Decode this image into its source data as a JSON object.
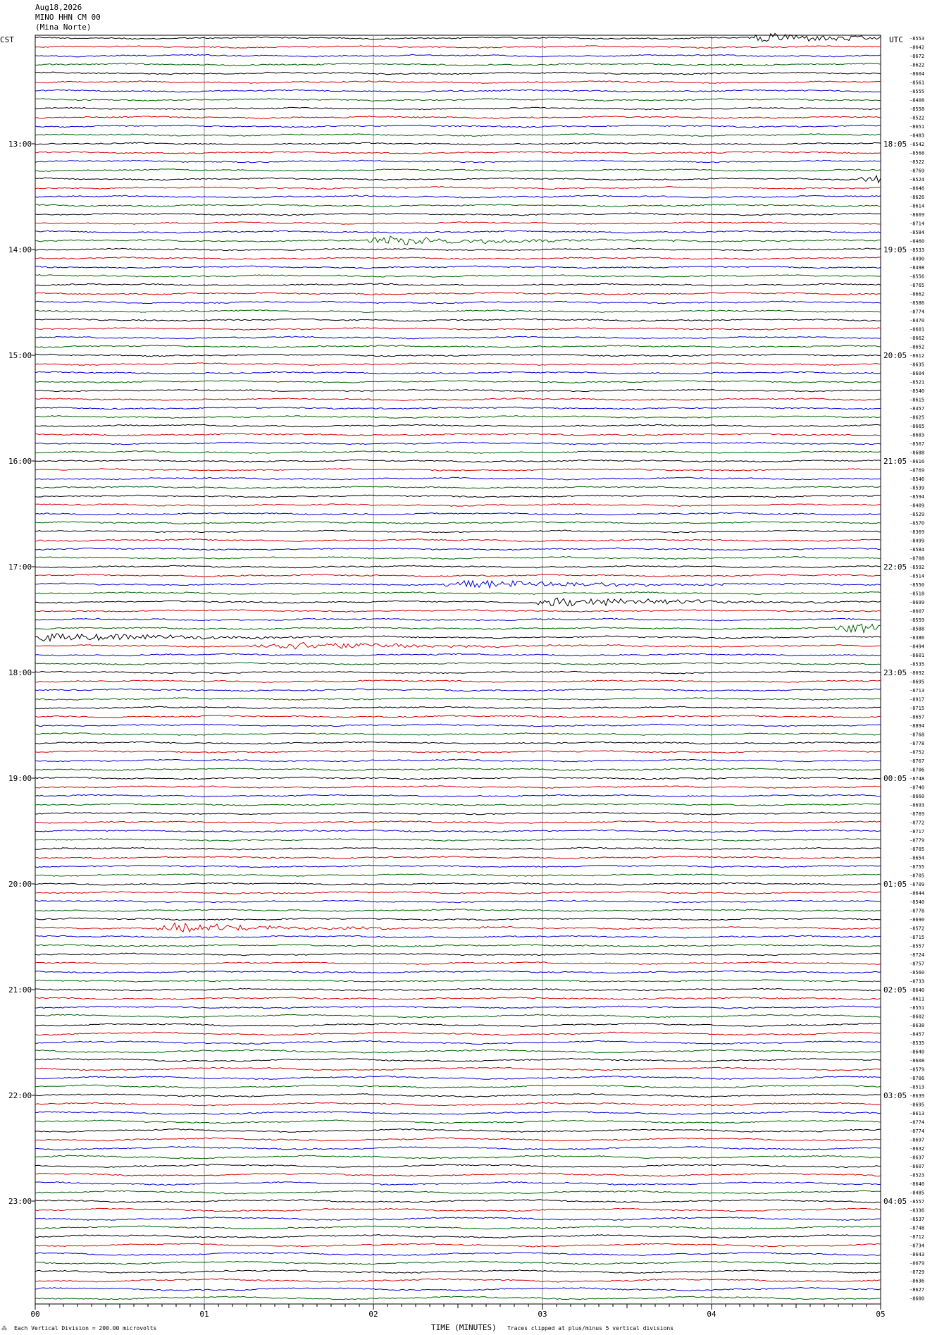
{
  "header": {
    "date": "Aug18,2026",
    "station": "MINO HHN CM 00",
    "location": "(Mina Norte)"
  },
  "left_tz": "CST",
  "right_tz": "UTC",
  "footer": {
    "scale_note": "Each Vertical Division =  200.00 microvolts",
    "xlabel": "TIME (MINUTES)",
    "clip_note": "Traces clipped at plus/minus 5 vertical divisions"
  },
  "chart_data": {
    "type": "line",
    "title": "",
    "xlabel": "TIME (MINUTES)",
    "ylabel": "",
    "xlim": [
      0,
      5
    ],
    "x_ticks": [
      "00",
      "01",
      "02",
      "03",
      "04",
      "05"
    ],
    "trace_colors": [
      "#000000",
      "#d00000",
      "#0000d0",
      "#006000"
    ],
    "trace_count": 144,
    "left_time_labels": [
      "13:00",
      "14:00",
      "15:00",
      "16:00",
      "17:00",
      "18:00",
      "19:00",
      "20:00",
      "21:00",
      "22:00",
      "23:00"
    ],
    "right_time_labels": [
      "18:05",
      "19:05",
      "20:05",
      "21:05",
      "22:05",
      "23:05",
      "00:05",
      "01:05",
      "02:05",
      "03:05",
      "04:05"
    ],
    "trace_offsets": [
      -8553,
      -8642,
      -8672,
      -8622,
      -8604,
      -8561,
      -8555,
      -8408,
      -8558,
      -8522,
      -8651,
      -8483,
      -8542,
      -8568,
      -8522,
      -8769,
      -8524,
      -8646,
      -8626,
      -8614,
      -8669,
      -8714,
      -8584,
      -8460,
      -8533,
      -8490,
      -8498,
      -8556,
      -8765,
      -8662,
      -8586,
      -8774,
      -8470,
      -8601,
      -8662,
      -8652,
      -8612,
      -8635,
      -8604,
      -8521,
      -8540,
      -8615,
      -8457,
      -8625,
      -8665,
      -8683,
      -8567,
      -8688,
      -8616,
      -8769,
      -8546,
      -8539,
      -8594,
      -8409,
      -8529,
      -8570,
      -8369,
      -8499,
      -8584,
      -8708,
      -8592,
      -8514,
      -8550,
      -8518,
      -8699,
      -8607,
      -8559,
      -8588,
      -8386,
      -8494,
      -8601,
      -8535,
      -8692,
      -8695,
      -8713,
      -8917,
      -8715,
      -8657,
      -8894,
      -8768,
      -8778,
      -8752,
      -8767,
      -8706,
      -8748,
      -8740,
      -8660,
      -8693,
      -8769,
      -8772,
      -8717,
      -8779,
      -8705,
      -8654,
      -8755,
      -8705,
      -8709,
      -8644,
      -8540,
      -8778,
      -8690,
      -8572,
      -8715,
      -8557,
      -8724,
      -8757,
      -8560,
      -8733,
      -8640,
      -8611,
      -8551,
      -8602,
      -8638,
      -8457,
      -8535,
      -8640,
      -8608,
      -8579,
      -8706,
      -8513,
      -8639,
      -8695,
      -8613,
      -8774,
      -8774,
      -8697,
      -8632,
      -8637,
      -8607,
      -8523,
      -8640,
      -8485,
      -8557,
      -8336,
      -8537,
      -8748,
      -8712,
      -8734,
      -8643,
      -8679,
      -8729,
      -8636,
      -8627,
      -8600
    ],
    "events": [
      {
        "trace": 0,
        "x": 4.27
      },
      {
        "trace": 16,
        "x": 4.95
      },
      {
        "trace": 23,
        "x": 2.05
      },
      {
        "trace": 62,
        "x": 2.5
      },
      {
        "trace": 64,
        "x": 3.05
      },
      {
        "trace": 67,
        "x": 4.8
      },
      {
        "trace": 68,
        "x": 0.05
      },
      {
        "trace": 69,
        "x": 1.38
      },
      {
        "trace": 101,
        "x": 0.8
      }
    ]
  }
}
